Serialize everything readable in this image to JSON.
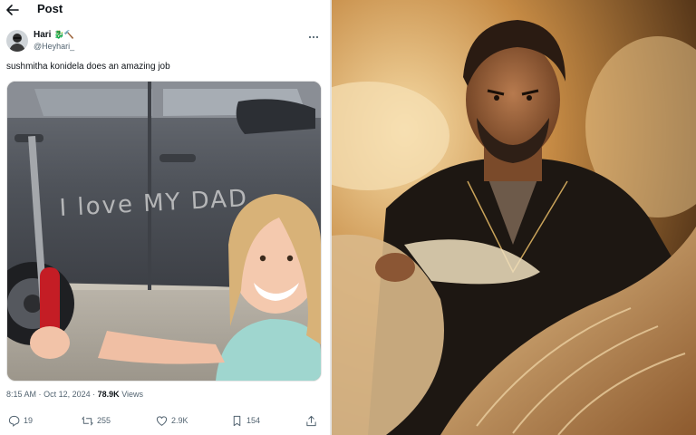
{
  "header": {
    "title": "Post"
  },
  "tweet": {
    "author": {
      "name": "Hari",
      "emoji": "🐉🔨",
      "handle": "@Heyhari_"
    },
    "text": "sushmitha konidela does an amazing job",
    "time": "8:15 AM",
    "sep": "·",
    "date": "Oct 12, 2024",
    "views_count": "78.9K",
    "views_label": "Views",
    "stats": {
      "replies": "19",
      "reposts": "255",
      "likes": "2.9K",
      "bookmarks": "154"
    }
  },
  "photo": {
    "car_writing": "I love MY DAD"
  },
  "colors": {
    "accent_text": "#0f1419",
    "muted": "#536471"
  }
}
